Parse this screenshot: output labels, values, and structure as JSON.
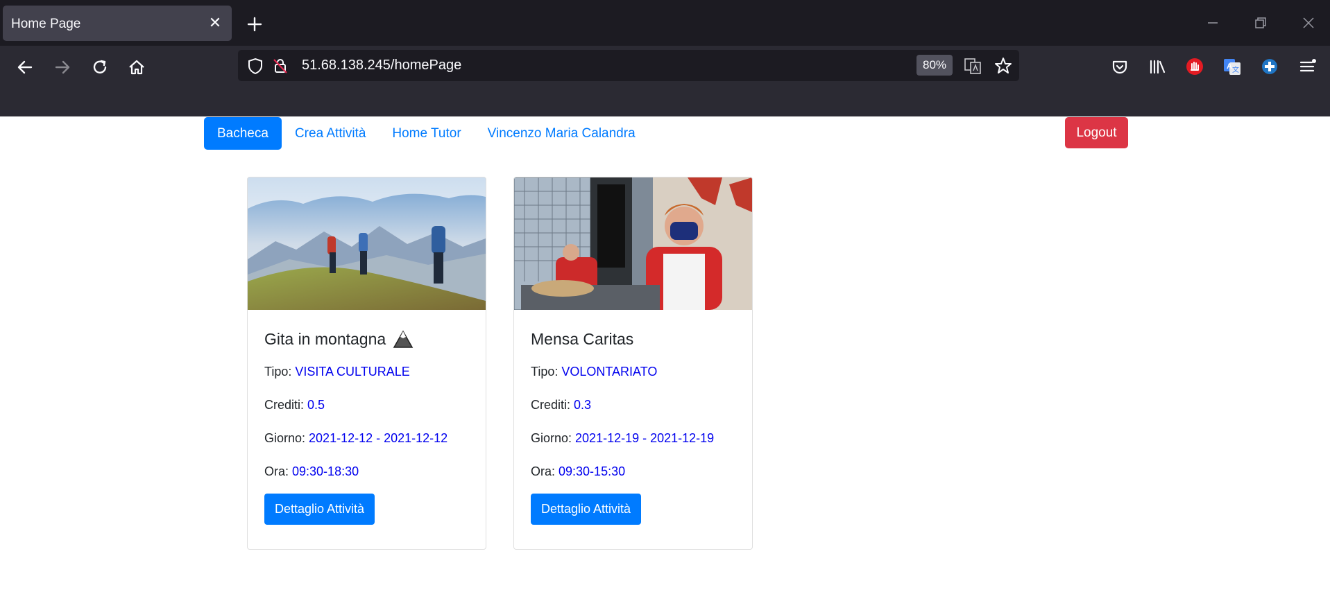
{
  "browser": {
    "tab_title": "Home Page",
    "url": "51.68.138.245/homePage",
    "zoom": "80%"
  },
  "nav": {
    "items": [
      {
        "label": "Bacheca",
        "active": true
      },
      {
        "label": "Crea Attività",
        "active": false
      },
      {
        "label": "Home Tutor",
        "active": false
      },
      {
        "label": "Vincenzo Maria Calandra",
        "active": false
      }
    ],
    "logout_label": "Logout"
  },
  "labels": {
    "tipo": "Tipo: ",
    "crediti": "Crediti: ",
    "giorno": "Giorno: ",
    "ora": "Ora: "
  },
  "cards": [
    {
      "title": "Gita in montagna",
      "title_icon": "mountain-icon",
      "tipo": "VISITA CULTURALE",
      "crediti": "0.5",
      "giorno": "2021-12-12 - 2021-12-12",
      "ora": "09:30-18:30",
      "button": "Dettaglio Attività"
    },
    {
      "title": "Mensa Caritas",
      "tipo": "VOLONTARIATO",
      "crediti": "0.3",
      "giorno": "2021-12-19 - 2021-12-19",
      "ora": "09:30-15:30",
      "button": "Dettaglio Attività"
    }
  ],
  "colors": {
    "primary": "#007bff",
    "danger": "#dc3545",
    "value_link": "#0000ee",
    "chrome_dark": "#1c1b22",
    "chrome": "#2b2a33"
  }
}
